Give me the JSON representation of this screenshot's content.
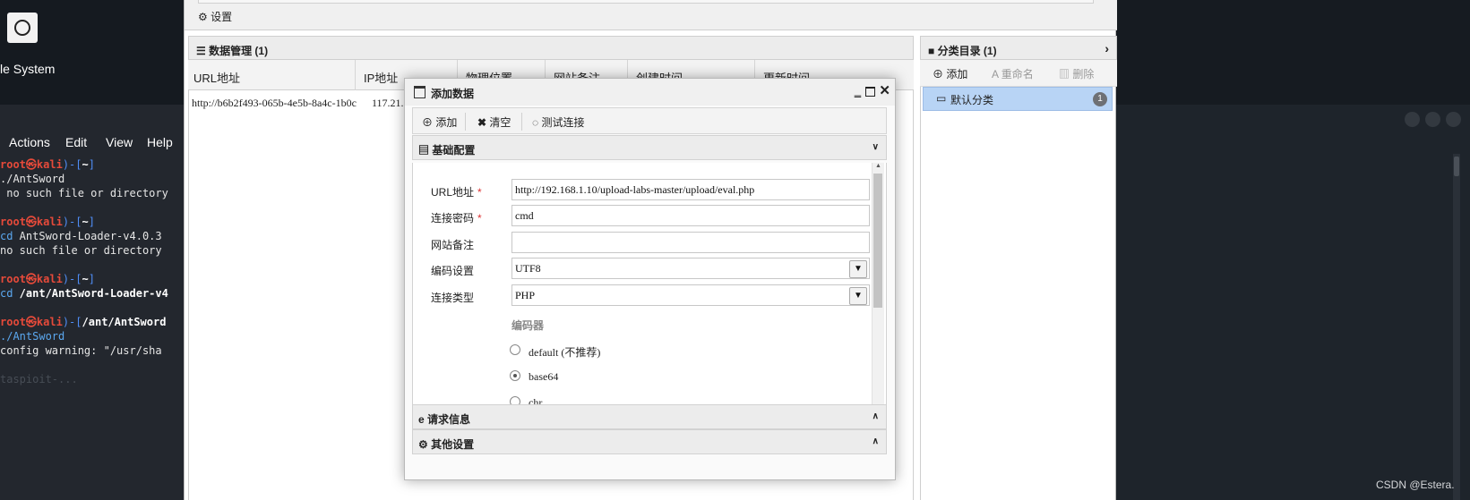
{
  "desktop": {
    "icon_label": "le System"
  },
  "terminal": {
    "menu": [
      "Actions",
      "Edit",
      "View",
      "Help"
    ],
    "lines": [
      {
        "parts": [
          {
            "t": "root",
            "c": "t-red"
          },
          {
            "t": "㉿",
            "c": "t-red"
          },
          {
            "t": "kali",
            "c": "t-red"
          },
          {
            "t": ")-[",
            "c": "t-blue"
          },
          {
            "t": "~",
            "c": "t-white"
          },
          {
            "t": "]",
            "c": "t-blue"
          }
        ]
      },
      {
        "parts": [
          {
            "t": "./AntSword",
            "c": ""
          }
        ]
      },
      {
        "parts": [
          {
            "t": " no such file or directory",
            "c": ""
          }
        ]
      },
      {
        "parts": [
          {
            "t": "",
            "c": ""
          }
        ]
      },
      {
        "parts": [
          {
            "t": "root",
            "c": "t-red"
          },
          {
            "t": "㉿",
            "c": "t-red"
          },
          {
            "t": "kali",
            "c": "t-red"
          },
          {
            "t": ")-[",
            "c": "t-blue"
          },
          {
            "t": "~",
            "c": "t-white"
          },
          {
            "t": "]",
            "c": "t-blue"
          }
        ]
      },
      {
        "parts": [
          {
            "t": "cd",
            "c": "t-cyan"
          },
          {
            "t": " AntSword-Loader-v4.0.3",
            "c": ""
          }
        ]
      },
      {
        "parts": [
          {
            "t": "no such file or directory",
            "c": ""
          }
        ]
      },
      {
        "parts": [
          {
            "t": "",
            "c": ""
          }
        ]
      },
      {
        "parts": [
          {
            "t": "root",
            "c": "t-red"
          },
          {
            "t": "㉿",
            "c": "t-red"
          },
          {
            "t": "kali",
            "c": "t-red"
          },
          {
            "t": ")-[",
            "c": "t-blue"
          },
          {
            "t": "~",
            "c": "t-white"
          },
          {
            "t": "]",
            "c": "t-blue"
          }
        ]
      },
      {
        "parts": [
          {
            "t": "cd",
            "c": "t-cyan"
          },
          {
            "t": " /ant/AntSword-Loader-v4",
            "c": "t-white"
          }
        ]
      },
      {
        "parts": [
          {
            "t": "",
            "c": ""
          }
        ]
      },
      {
        "parts": [
          {
            "t": "root",
            "c": "t-red"
          },
          {
            "t": "㉿",
            "c": "t-red"
          },
          {
            "t": "kali",
            "c": "t-red"
          },
          {
            "t": ")-[",
            "c": "t-blue"
          },
          {
            "t": "/ant/AntSword",
            "c": "t-white"
          }
        ]
      },
      {
        "parts": [
          {
            "t": "./AntSword",
            "c": "t-cyan"
          }
        ]
      },
      {
        "parts": [
          {
            "t": "config warning: \"/usr/sha",
            "c": ""
          }
        ]
      },
      {
        "parts": [
          {
            "t": "",
            "c": ""
          }
        ]
      },
      {
        "parts": [
          {
            "t": "taspioit-...",
            "c": "t-dim"
          }
        ]
      }
    ]
  },
  "watermark": "CSDN @Estera.",
  "app": {
    "settings_label": "设置",
    "data_panel_title": "数据管理 (1)",
    "columns": [
      "URL地址",
      "IP地址",
      "物理位置",
      "网站备注",
      "创建时间",
      "更新时间"
    ],
    "row": {
      "url": "http://b6b2f493-065b-4e5b-8a4c-1b0c",
      "ip": "117.21."
    },
    "category_title": "分类目录 (1)",
    "category_actions": {
      "add": "添加",
      "rename": "重命名",
      "delete": "删除"
    },
    "category_item": {
      "label": "默认分类",
      "count": "1"
    }
  },
  "dialog": {
    "title": "添加数据",
    "toolbar": {
      "add": "添加",
      "clear": "清空",
      "test": "测试连接"
    },
    "section_basic": "基础配置",
    "fields": {
      "url_label": "URL地址",
      "url_value": "http://192.168.1.10/upload-labs-master/upload/eval.php",
      "password_label": "连接密码",
      "password_value": "cmd",
      "note_label": "网站备注",
      "note_value": "",
      "encoding_label": "编码设置",
      "encoding_value": "UTF8",
      "type_label": "连接类型",
      "type_value": "PHP"
    },
    "encoder": {
      "title": "编码器",
      "options": [
        "default (不推荐)",
        "base64",
        "chr"
      ],
      "selected": "base64"
    },
    "section_request": "请求信息",
    "section_other": "其他设置"
  },
  "colors": {
    "selection": "#b8d4f5",
    "required": "#d33333",
    "terminal_prompt": "#e64a3a"
  }
}
